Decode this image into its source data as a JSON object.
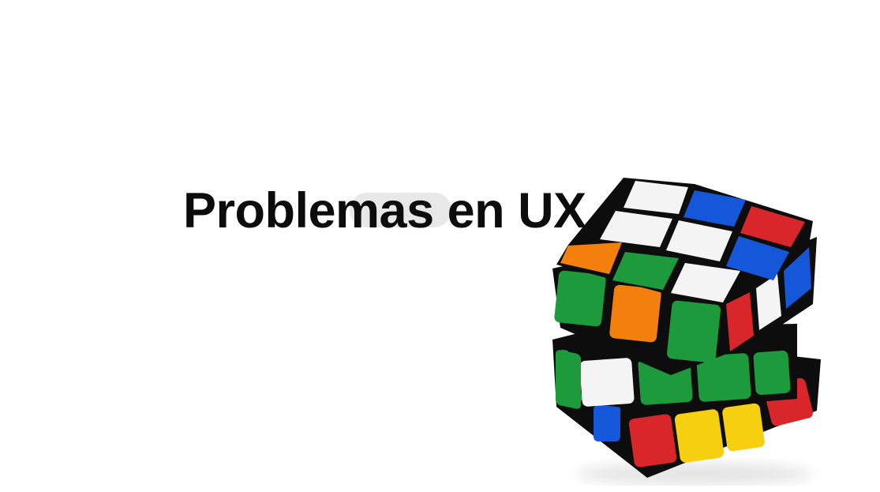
{
  "slide": {
    "title": "Problemas en UX"
  },
  "image": {
    "subject": "rubiks-cube",
    "colors": {
      "white": "#f4f4f4",
      "blue": "#1457d8",
      "red": "#d8262a",
      "orange": "#f3800d",
      "green": "#1d9a3c",
      "yellow": "#f6cf10",
      "body": "#0d0d0d"
    }
  }
}
